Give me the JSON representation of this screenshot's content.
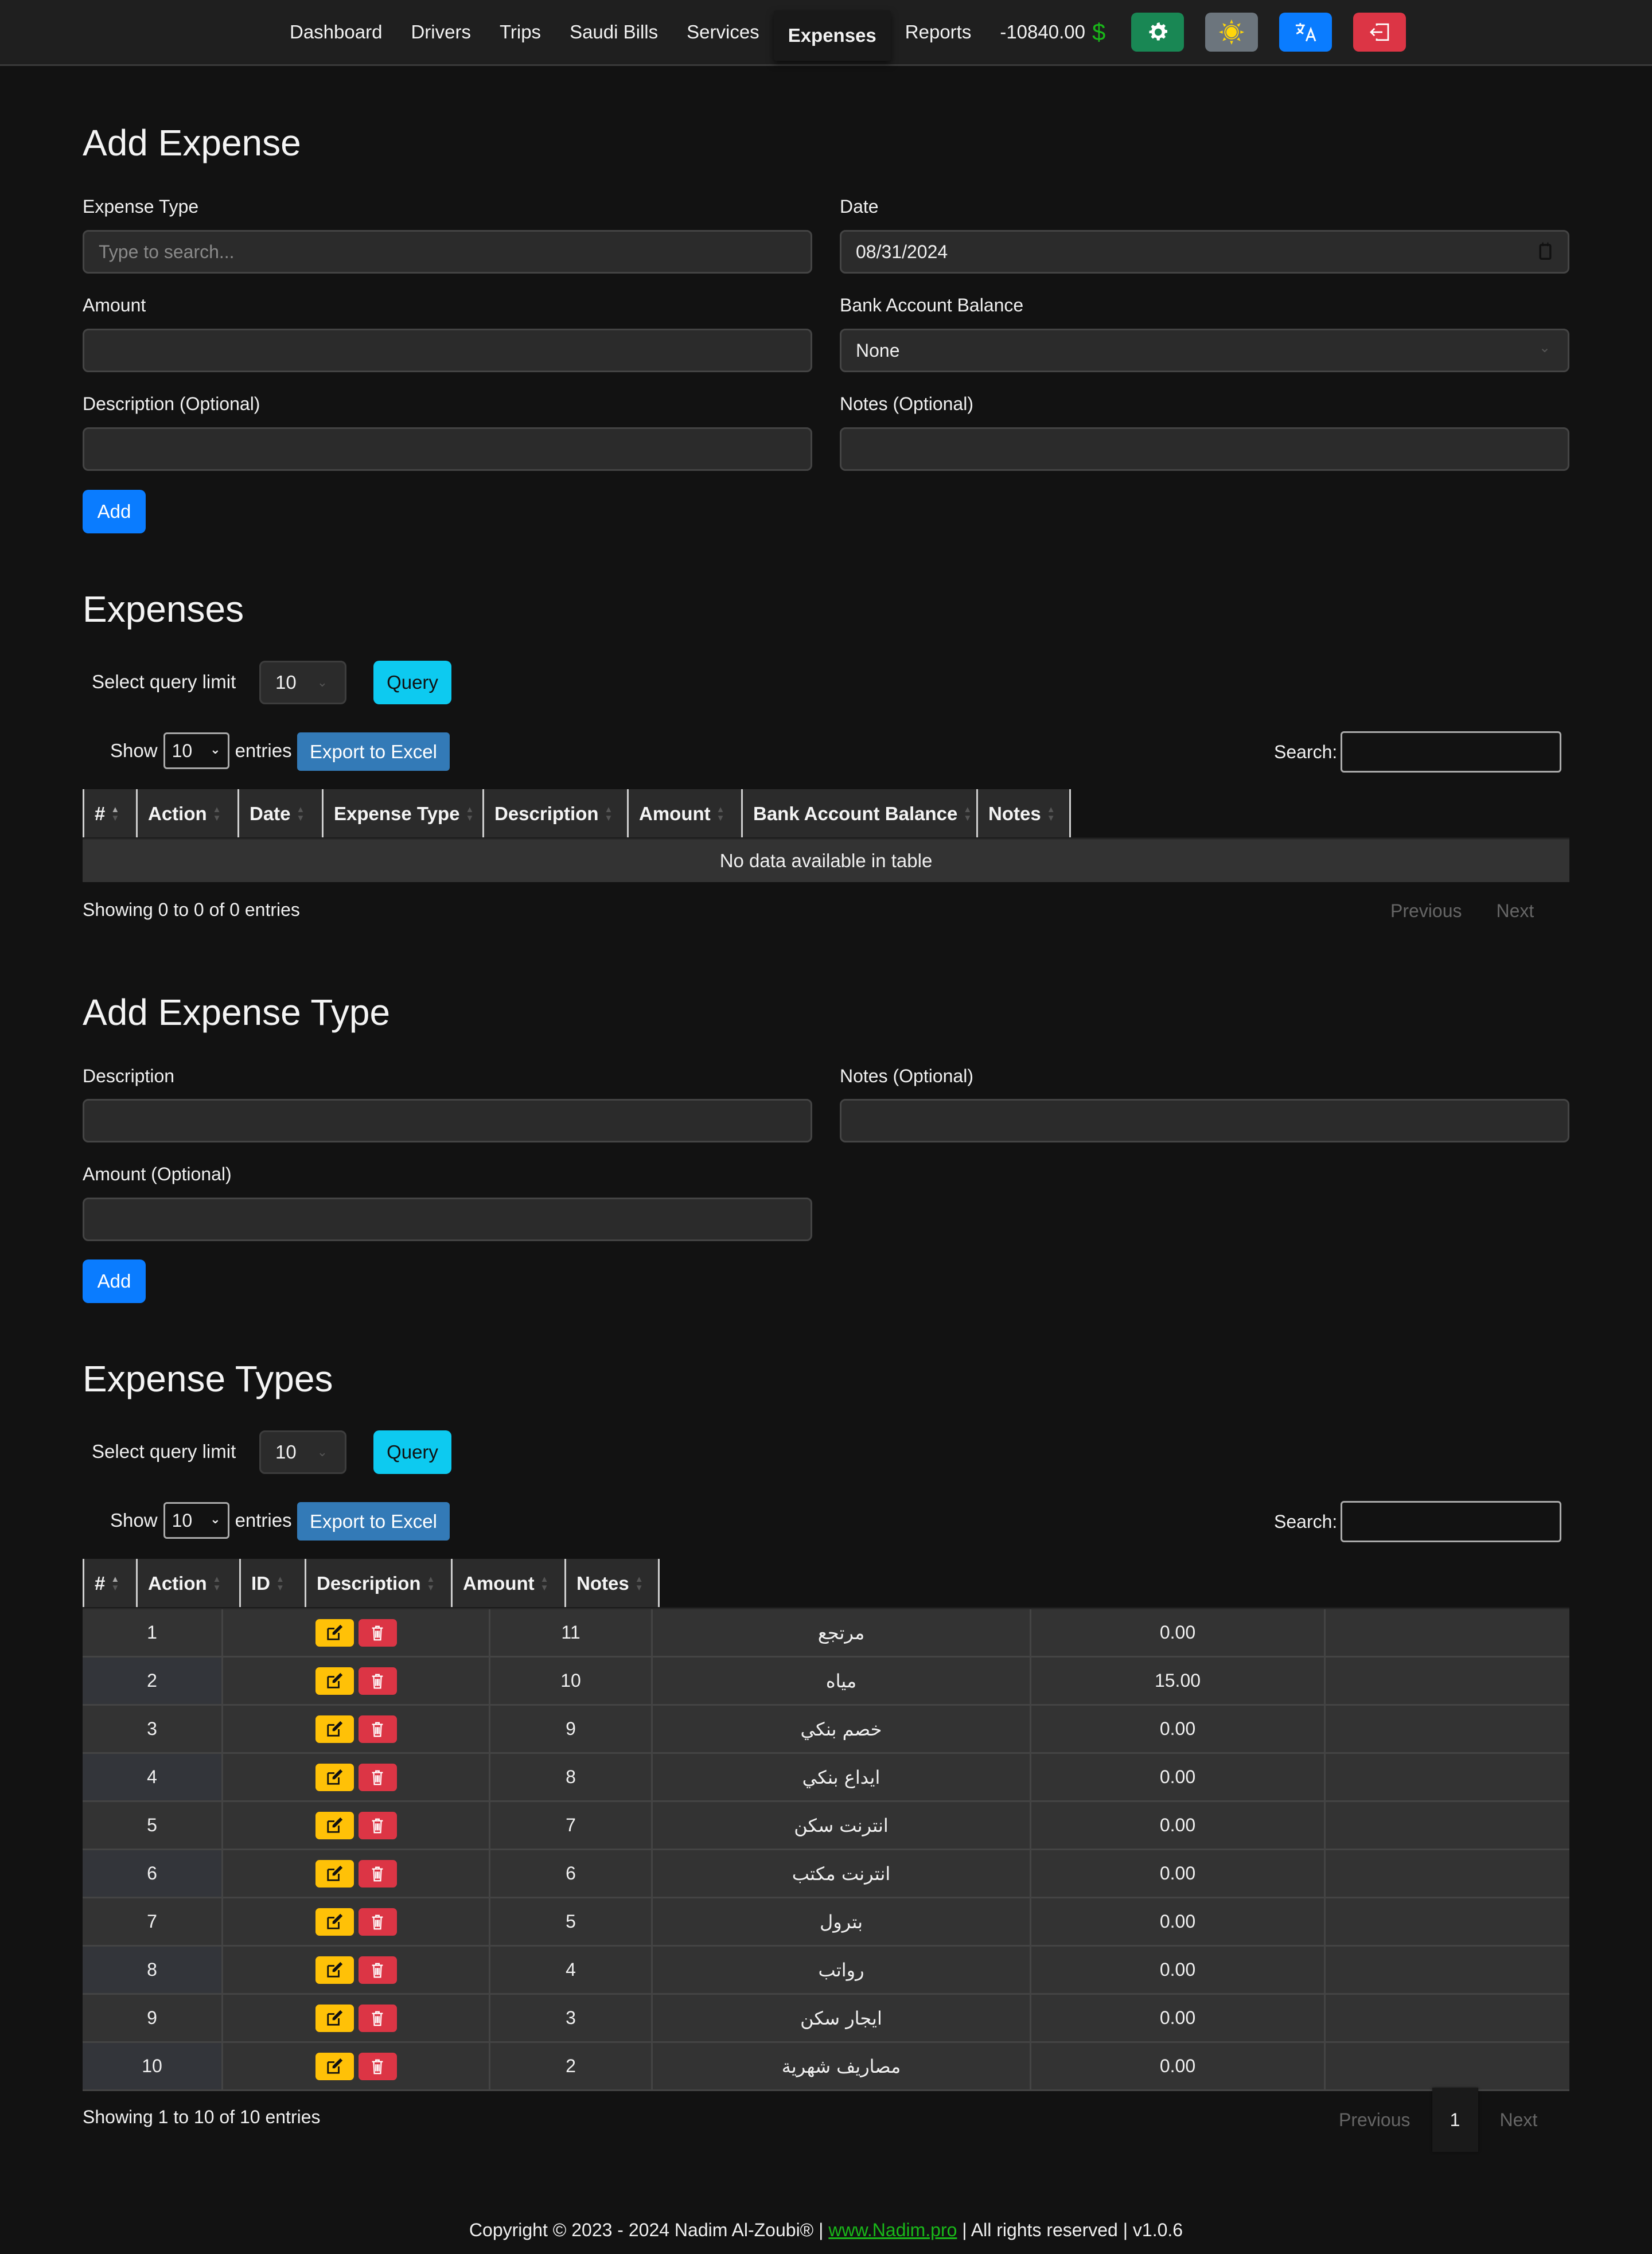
{
  "navbar": {
    "links": [
      "Dashboard",
      "Drivers",
      "Trips",
      "Saudi Bills",
      "Services",
      "Expenses",
      "Reports"
    ],
    "active": "Expenses",
    "balance": "-10840.00",
    "currency_icon": "dollar-icon",
    "buttons": [
      {
        "name": "settings-button",
        "icon": "gear-icon",
        "color": "#198754"
      },
      {
        "name": "theme-toggle-button",
        "icon": "sun-icon",
        "color": "#6c757d"
      },
      {
        "name": "language-button",
        "icon": "translate-icon",
        "color": "#0a7cff"
      },
      {
        "name": "logout-button",
        "icon": "logout-icon",
        "color": "#dc3545"
      }
    ]
  },
  "add_expense": {
    "title": "Add Expense",
    "expense_type_label": "Expense Type",
    "expense_type_placeholder": "Type to search...",
    "date_label": "Date",
    "date_value": "08/31/2024",
    "amount_label": "Amount",
    "amount_value": "",
    "bank_label": "Bank Account Balance",
    "bank_value": "None",
    "description_label": "Description (Optional)",
    "notes_label": "Notes (Optional)",
    "add_button": "Add"
  },
  "expenses": {
    "title": "Expenses",
    "query_limit_label": "Select query limit",
    "query_limit_value": "10",
    "query_button": "Query",
    "show_label": "Show",
    "show_value": "10",
    "entries_label": "entries",
    "export_button": "Export to Excel",
    "search_label": "Search:",
    "columns": [
      "#",
      "Action",
      "Date",
      "Expense Type",
      "Description",
      "Amount",
      "Bank Account Balance",
      "Notes"
    ],
    "empty_message": "No data available in table",
    "info": "Showing 0 to 0 of 0 entries",
    "prev": "Previous",
    "next": "Next"
  },
  "add_expense_type": {
    "title": "Add Expense Type",
    "description_label": "Description",
    "notes_label": "Notes (Optional)",
    "amount_label": "Amount (Optional)",
    "add_button": "Add"
  },
  "expense_types": {
    "title": "Expense Types",
    "query_limit_label": "Select query limit",
    "query_limit_value": "10",
    "query_button": "Query",
    "show_label": "Show",
    "show_value": "10",
    "entries_label": "entries",
    "export_button": "Export to Excel",
    "search_label": "Search:",
    "columns": [
      "#",
      "Action",
      "ID",
      "Description",
      "Amount",
      "Notes"
    ],
    "rows": [
      {
        "n": "1",
        "id": "11",
        "description": "مرتجع",
        "amount": "0.00",
        "notes": ""
      },
      {
        "n": "2",
        "id": "10",
        "description": "مياه",
        "amount": "15.00",
        "notes": ""
      },
      {
        "n": "3",
        "id": "9",
        "description": "خصم بنكي",
        "amount": "0.00",
        "notes": ""
      },
      {
        "n": "4",
        "id": "8",
        "description": "ايداع بنكي",
        "amount": "0.00",
        "notes": ""
      },
      {
        "n": "5",
        "id": "7",
        "description": "انترنت سكن",
        "amount": "0.00",
        "notes": ""
      },
      {
        "n": "6",
        "id": "6",
        "description": "انترنت مكتب",
        "amount": "0.00",
        "notes": ""
      },
      {
        "n": "7",
        "id": "5",
        "description": "بترول",
        "amount": "0.00",
        "notes": ""
      },
      {
        "n": "8",
        "id": "4",
        "description": "رواتب",
        "amount": "0.00",
        "notes": ""
      },
      {
        "n": "9",
        "id": "3",
        "description": "ايجار سكن",
        "amount": "0.00",
        "notes": ""
      },
      {
        "n": "10",
        "id": "2",
        "description": "مصاريف شهرية",
        "amount": "0.00",
        "notes": ""
      }
    ],
    "info": "Showing 1 to 10 of 10 entries",
    "prev": "Previous",
    "page": "1",
    "next": "Next"
  },
  "footer": {
    "prefix": "Copyright © 2023 - 2024 Nadim Al-Zoubi® | ",
    "link": "www.Nadim.pro",
    "suffix": " | All rights reserved | v1.0.6"
  }
}
